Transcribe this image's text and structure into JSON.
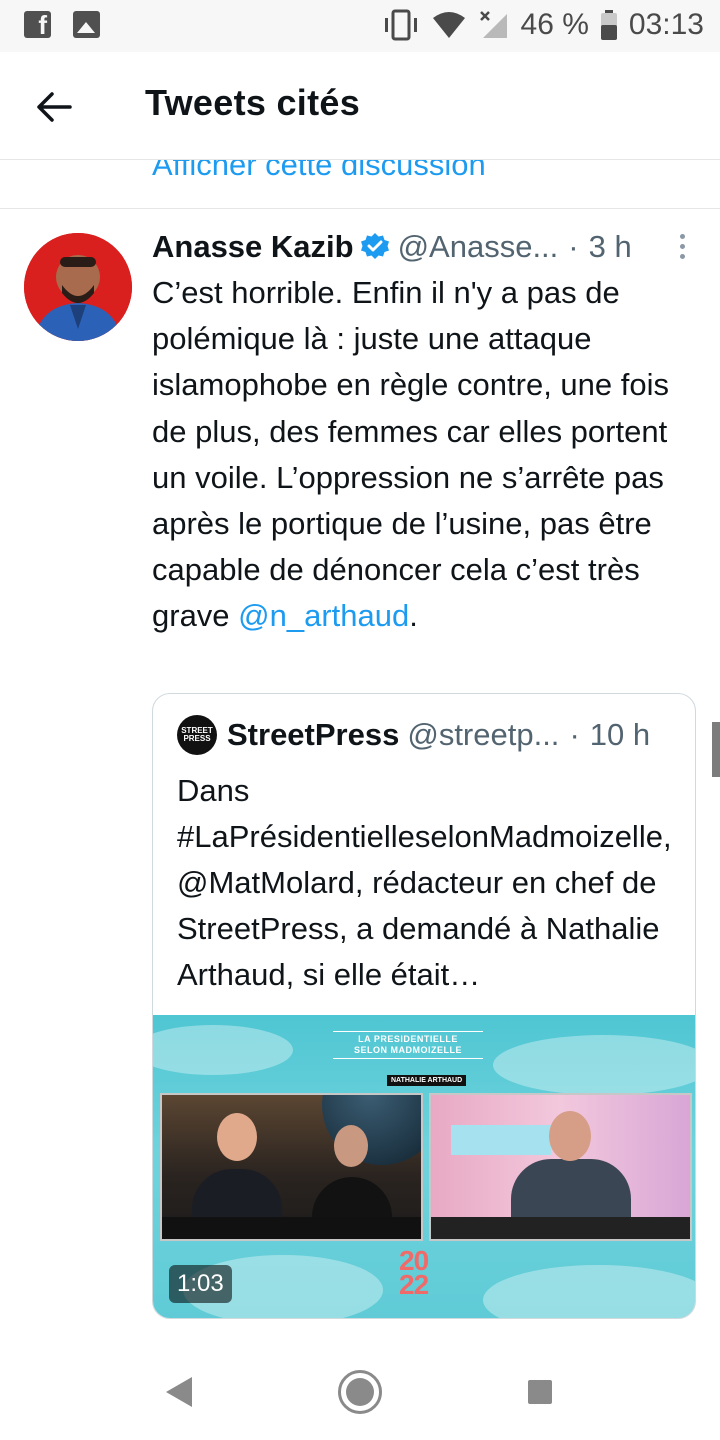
{
  "status_bar": {
    "left_icons": [
      "facebook-icon",
      "gallery-icon"
    ],
    "right_icons": [
      "vibrate-icon",
      "wifi-icon",
      "signal-off-icon",
      "battery-icon"
    ],
    "battery": "46 %",
    "time": "03:13"
  },
  "app_bar": {
    "back_icon": "arrow-left-icon",
    "title": "Tweets cités"
  },
  "partial_link": "Afficher cette discussion",
  "tweet": {
    "author": "Anasse Kazib",
    "verified": true,
    "handle": "@Anasse...",
    "separator": "·",
    "time": "3 h",
    "text": "C’est horrible. Enfin il n'y a pas de polémique là : juste une attaque islamophobe en règle contre, une fois de plus, des femmes car elles portent un voile. L’oppression ne s’arrête pas après le portique de l’usine, pas être capable de dénoncer cela c’est très grave",
    "mention": "@n_arthaud",
    "text_end": "."
  },
  "quoted_tweet": {
    "logo_text": [
      "STREET",
      "PRESS"
    ],
    "author": "StreetPress",
    "handle": "@streetp...",
    "separator": "·",
    "time": "10 h",
    "text": "Dans #LaPrésidentielleselonMadmoizelle, @MatMolard, rédacteur en chef de StreetPress, a demandé à Nathalie Arthaud, si elle était…",
    "media": {
      "title_line1": "LA PRESIDENTIELLE",
      "title_line2": "SELON MADMOIZELLE",
      "subtitle": "NATHALIE ARTHAUD",
      "year_top": "20",
      "year_bottom": "22",
      "duration": "1:03"
    }
  },
  "nav_bar": {
    "icons": [
      "nav-back-icon",
      "nav-home-icon",
      "nav-recents-icon"
    ]
  }
}
